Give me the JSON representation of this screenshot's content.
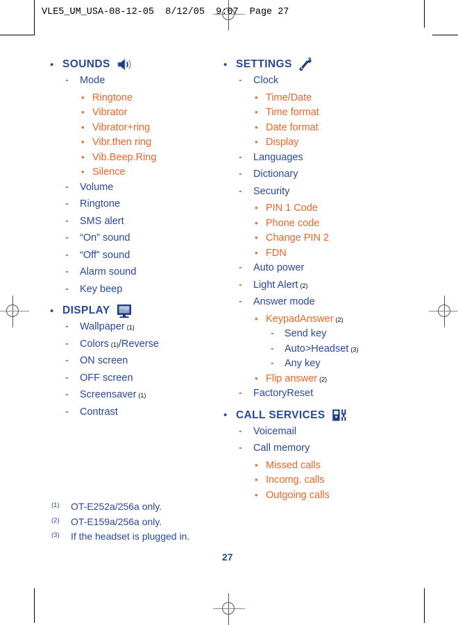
{
  "print_slug": "VLE5_UM_USA-08-12-05  8/12/05  9:07  Page 27",
  "colors": {
    "blue": "#27489a",
    "orange": "#ef6324",
    "black": "#000000"
  },
  "left_column": [
    {
      "level": 1,
      "bullet": "•",
      "text": "SOUNDS",
      "icon": "speaker-icon"
    },
    {
      "level": 2,
      "bullet": "-",
      "text": "Mode"
    },
    {
      "level": 3,
      "bullet": "•",
      "text": "Ringtone"
    },
    {
      "level": 3,
      "bullet": "•",
      "text": "Vibrator"
    },
    {
      "level": 3,
      "bullet": "•",
      "text": "Vibrator+ring"
    },
    {
      "level": 3,
      "bullet": "•",
      "text": "Vibr.then ring"
    },
    {
      "level": 3,
      "bullet": "•",
      "text": "Vib.Beep.Ring"
    },
    {
      "level": 3,
      "bullet": "•",
      "text": "Silence"
    },
    {
      "level": 2,
      "bullet": "-",
      "text": "Volume"
    },
    {
      "level": 2,
      "bullet": "-",
      "text": "Ringtone"
    },
    {
      "level": 2,
      "bullet": "-",
      "text": "SMS alert"
    },
    {
      "level": 2,
      "bullet": "-",
      "text": "“On” sound"
    },
    {
      "level": 2,
      "bullet": "-",
      "text": "“Off” sound"
    },
    {
      "level": 2,
      "bullet": "-",
      "text": "Alarm sound"
    },
    {
      "level": 2,
      "bullet": "-",
      "text": "Key beep"
    },
    {
      "level": 1,
      "bullet": "•",
      "text": "DISPLAY",
      "icon": "monitor-icon"
    },
    {
      "level": 2,
      "bullet": "-",
      "text": "Wallpaper",
      "sup": "(1)"
    },
    {
      "level": 2,
      "bullet": "-",
      "text": "Colors",
      "sup": "(1)",
      "text_after": "/Reverse"
    },
    {
      "level": 2,
      "bullet": "-",
      "text": "ON screen"
    },
    {
      "level": 2,
      "bullet": "-",
      "text": "OFF screen"
    },
    {
      "level": 2,
      "bullet": "-",
      "text": "Screensaver",
      "sup": "(1)"
    },
    {
      "level": 2,
      "bullet": "-",
      "text": "Contrast"
    }
  ],
  "right_column": [
    {
      "level": 1,
      "bullet": "•",
      "text": "SETTINGS",
      "icon": "wrench-icon"
    },
    {
      "level": 2,
      "bullet": "-",
      "text": "Clock"
    },
    {
      "level": 3,
      "bullet": "•",
      "text": "Time/Date"
    },
    {
      "level": 3,
      "bullet": "•",
      "text": "Time format"
    },
    {
      "level": 3,
      "bullet": "•",
      "text": "Date format"
    },
    {
      "level": 3,
      "bullet": "•",
      "text": "Display"
    },
    {
      "level": 2,
      "bullet": "-",
      "text": "Languages"
    },
    {
      "level": 2,
      "bullet": "-",
      "text": "Dictionary"
    },
    {
      "level": 2,
      "bullet": "-",
      "text": "Security"
    },
    {
      "level": 3,
      "bullet": "•",
      "text": "PIN 1 Code"
    },
    {
      "level": 3,
      "bullet": "•",
      "text": "Phone code"
    },
    {
      "level": 3,
      "bullet": "•",
      "text": "Change PIN 2"
    },
    {
      "level": 3,
      "bullet": "•",
      "text": "FDN"
    },
    {
      "level": 2,
      "bullet": "-",
      "text": "Auto power"
    },
    {
      "level": 2,
      "bullet": "-",
      "text": "Light Alert",
      "sup": "(2)"
    },
    {
      "level": 2,
      "bullet": "-",
      "text": "Answer mode"
    },
    {
      "level": 3,
      "bullet": "•",
      "text": "KeypadAnswer",
      "sup": "(2)"
    },
    {
      "level": 4,
      "bullet": "-",
      "text": "Send key"
    },
    {
      "level": 4,
      "bullet": "-",
      "text": "Auto>Headset",
      "sup": "(3)"
    },
    {
      "level": 4,
      "bullet": "-",
      "text": "Any key"
    },
    {
      "level": 3,
      "bullet": "•",
      "text": "Flip answer",
      "sup": "(2)"
    },
    {
      "level": 2,
      "bullet": "-",
      "text": "FactoryReset"
    },
    {
      "level": 1,
      "bullet": "•",
      "text": "CALL SERVICES",
      "icon": "phone-icon"
    },
    {
      "level": 2,
      "bullet": "-",
      "text": "Voicemail"
    },
    {
      "level": 2,
      "bullet": "-",
      "text": "Call memory"
    },
    {
      "level": 3,
      "bullet": "•",
      "text": "Missed calls"
    },
    {
      "level": 3,
      "bullet": "•",
      "text": "Incomg. calls"
    },
    {
      "level": 3,
      "bullet": "•",
      "text": "Outgoing calls"
    }
  ],
  "footnotes": [
    {
      "mark": "(1)",
      "text": "OT-E252a/256a only."
    },
    {
      "mark": "(2)",
      "text": "OT-E159a/256a only."
    },
    {
      "mark": "(3)",
      "text": "If the headset is plugged in."
    }
  ],
  "page_number": "27"
}
